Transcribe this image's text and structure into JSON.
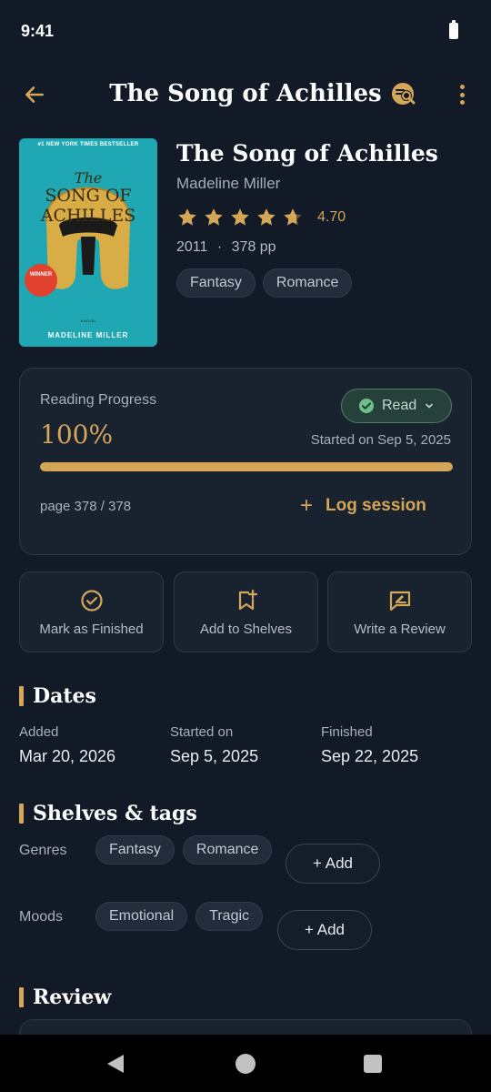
{
  "status_bar": {
    "time": "9:41"
  },
  "app_bar": {
    "title": "The Song of Achilles"
  },
  "cover": {
    "top_banner": "#1 NEW YORK TIMES BESTSELLER",
    "title_the": "The",
    "title_main": "SONG OF ACHILLES",
    "badge": "WINNER",
    "novel_label": "A NOVEL",
    "author": "MADELINE MILLER"
  },
  "book": {
    "title": "The Song of Achilles",
    "author": "Madeline Miller",
    "rating": 4.7,
    "rating_label": "4.70",
    "year": "2011",
    "separator": "·",
    "pages": "378 pp",
    "genres": [
      "Fantasy",
      "Romance"
    ]
  },
  "progress": {
    "label": "Reading Progress",
    "value_label": "100%",
    "fraction": 1.0,
    "status": "Read",
    "started": "Started on Sep 5, 2025",
    "page_text": "page 378 / 378",
    "log_plus": "+",
    "log_label": "Log session"
  },
  "actions": [
    {
      "label": "Mark as Finished",
      "icon": "check-circle-icon"
    },
    {
      "label": "Add to Shelves",
      "icon": "bookmark-plus-icon"
    },
    {
      "label": "Write a Review",
      "icon": "edit-review-icon"
    }
  ],
  "dates": {
    "title": "Dates",
    "items": [
      {
        "label": "Added",
        "value": "Mar 20, 2026"
      },
      {
        "label": "Started on",
        "value": "Sep 5, 2025"
      },
      {
        "label": "Finished",
        "value": "Sep 22, 2025"
      }
    ]
  },
  "shelves": {
    "title": "Shelves & tags",
    "genres_label": "Genres",
    "genres": [
      "Fantasy",
      "Romance"
    ],
    "moods_label": "Moods",
    "moods": [
      "Emotional",
      "Tragic"
    ],
    "add_label": "+ Add"
  },
  "review": {
    "title": "Review"
  },
  "colors": {
    "accent": "#d5a558",
    "background": "#111a26",
    "card": "#19222f",
    "read_green": "#6fbf8b"
  }
}
